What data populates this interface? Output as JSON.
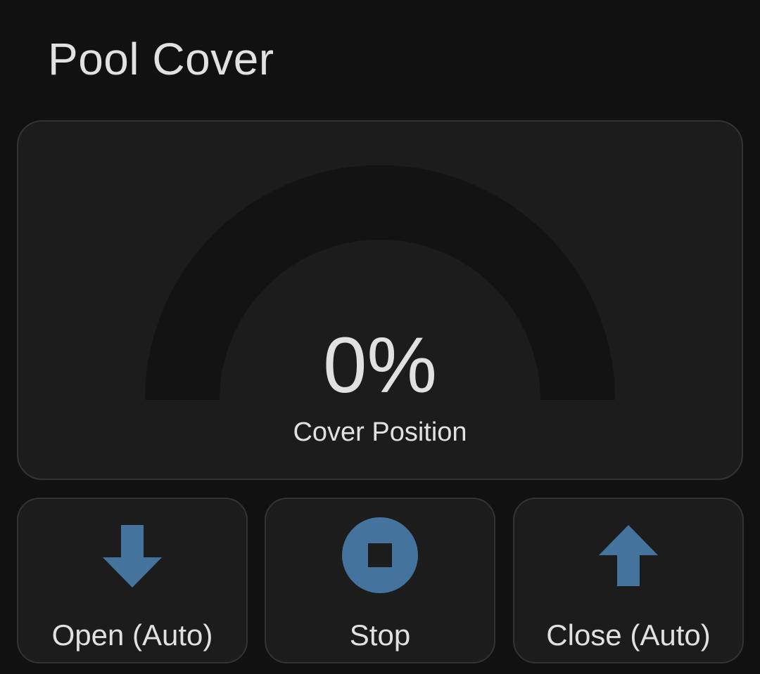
{
  "card": {
    "title": "Pool Cover"
  },
  "gauge": {
    "value_text": "0%",
    "value": 0,
    "min": 0,
    "max": 100,
    "label": "Cover Position",
    "track_color": "#131313",
    "fill_color": "#44739e"
  },
  "buttons": [
    {
      "label": "Open (Auto)",
      "icon": "arrow-down-icon"
    },
    {
      "label": "Stop",
      "icon": "stop-circle-icon"
    },
    {
      "label": "Close (Auto)",
      "icon": "arrow-up-icon"
    }
  ],
  "colors": {
    "background": "#111111",
    "card_background": "#1c1c1c",
    "card_border": "#333333",
    "text": "#e1e1e1",
    "icon_accent": "#44739e"
  }
}
